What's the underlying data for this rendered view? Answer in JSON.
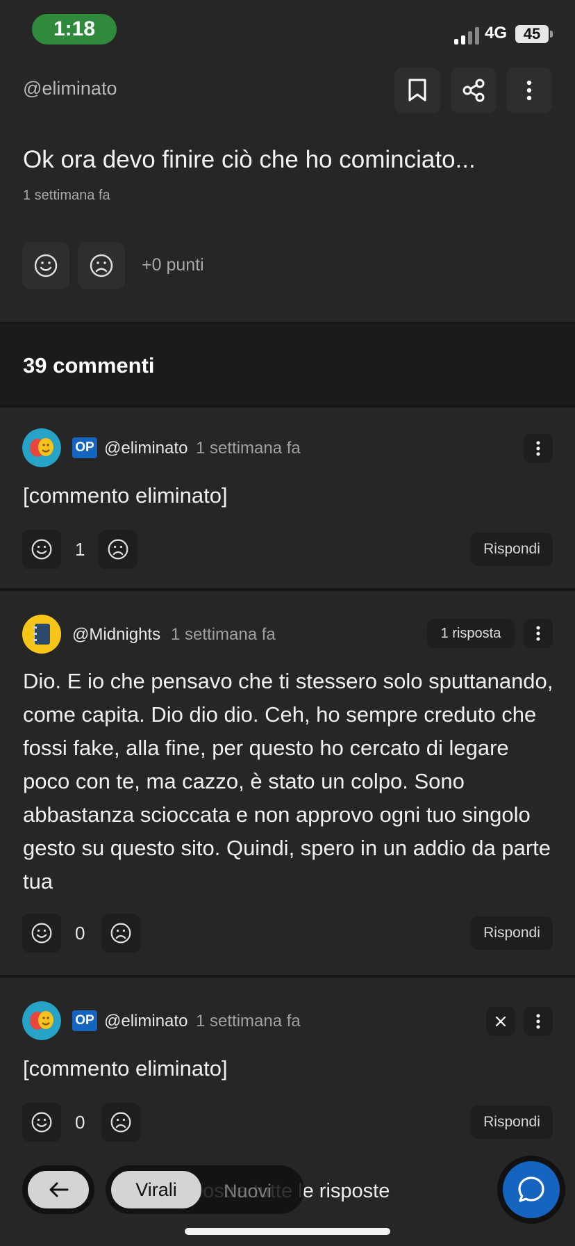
{
  "status_bar": {
    "time": "1:18",
    "network": "4G",
    "battery": "45"
  },
  "post": {
    "author": "@eliminato",
    "title": "Ok ora devo finire ciò che ho cominciato...",
    "time": "1 settimana fa",
    "points": "+0 punti"
  },
  "comments_header": {
    "count_label": "39 commenti"
  },
  "comments": [
    {
      "badge": "OP",
      "author": "@eliminato",
      "time": "1 settimana fa",
      "text": "[commento eliminato]",
      "score": "1",
      "reply_label": "Rispondi"
    },
    {
      "author": "@Midnights",
      "time": "1 settimana fa",
      "replies_label": "1 risposta",
      "text": "Dio. E io che pensavo che ti stessero solo sputtanando, come capita. Dio dio dio. Ceh, ho sempre creduto che fossi fake, alla fine, per questo ho cercato di legare poco con te, ma cazzo, è stato un colpo. Sono abbastanza scioccata e non approvo ogni tuo singolo gesto su questo sito. Quindi, spero in un addio da parte tua",
      "score": "0",
      "reply_label": "Rispondi"
    },
    {
      "badge": "OP",
      "author": "@eliminato",
      "time": "1 settimana fa",
      "text": "[commento eliminato]",
      "score": "0",
      "reply_label": "Rispondi"
    }
  ],
  "bottom_bar": {
    "show_all_label": "Mostra tutte le risposte",
    "tab_active": "Virali",
    "tab_inactive": "Nuovi"
  },
  "colors": {
    "accent": "#1565c0",
    "status_pill": "#2f8a3c",
    "background": "#262626"
  }
}
